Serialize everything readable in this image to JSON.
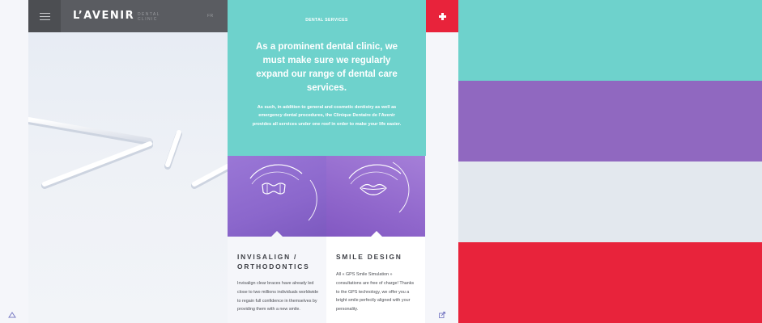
{
  "header": {
    "logo": "L’AVENIR",
    "logo_sub": "DENTAL CLINIC",
    "language": "FR"
  },
  "services": {
    "eyebrow": "DENTAL SERVICES",
    "headline": "As a prominent dental clinic, we must make sure we regularly expand our range of dental care services.",
    "body": "As such, in addition to general and cosmetic dentistry as well as emergency dental procedures, the Clinique Dentaire de l’Avenir provides all services under one roof in order to make your life easier."
  },
  "cards": [
    {
      "title": "INVISALIGN / ORTHODONTICS",
      "icon": "braces-icon",
      "text": "Invisalign clear braces have already led close to two millions individuals worldwide to regain full confidence in themselves by providing them with a new smile."
    },
    {
      "title": "SMILE DESIGN",
      "icon": "lips-icon",
      "text": "All « GPS Smile Simulation » consultations are free of charge! Thanks to the GPS technology, we offer you a bright smile perfectly aligned with your personality."
    }
  ],
  "icons": {
    "menu": "hamburger-menu-icon",
    "plus": "plus-icon",
    "scroll_top": "triangle-up-icon",
    "external": "external-link-icon"
  },
  "colors": {
    "header": "#5a5c61",
    "turquoise": "#6ed2cc",
    "purple": "#9068c0",
    "light_gray": "#e3e8ee",
    "red": "#e8233b"
  },
  "swatches": [
    {
      "name": "turquoise",
      "color": "#6ed2cc"
    },
    {
      "name": "purple",
      "color": "#9068c0"
    },
    {
      "name": "light-gray",
      "color": "#e3e8ee"
    },
    {
      "name": "red",
      "color": "#e8233b"
    }
  ]
}
